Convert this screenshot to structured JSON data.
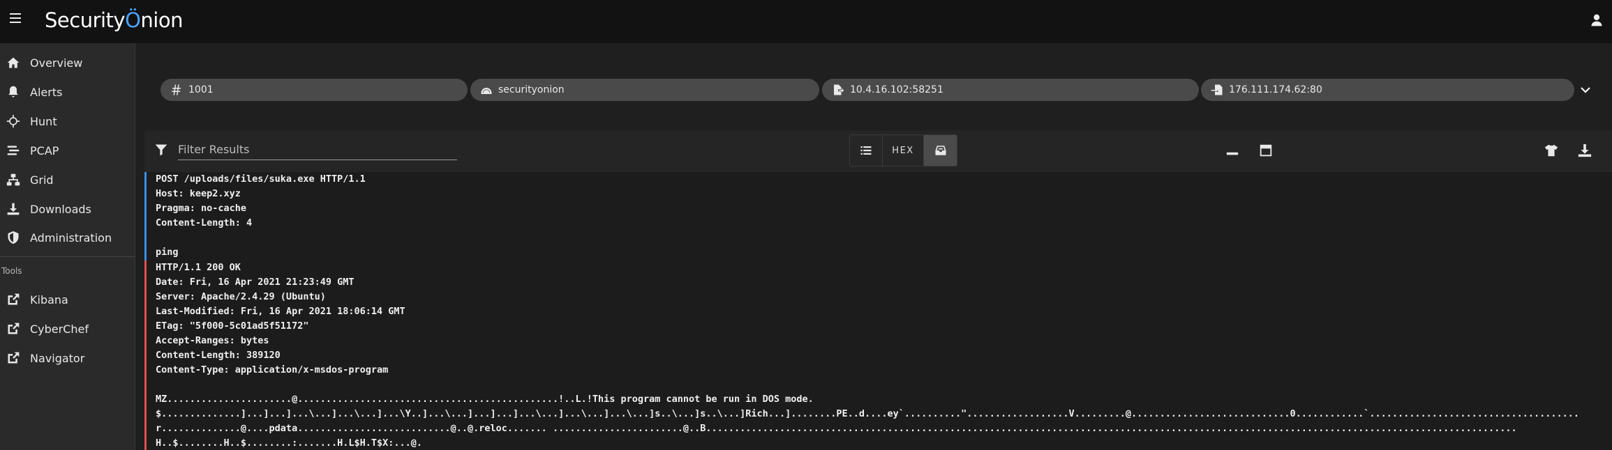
{
  "app": {
    "logo_part1": "Security",
    "logo_part2": "nion"
  },
  "sidebar": {
    "items": [
      {
        "label": "Overview",
        "icon": "home-icon"
      },
      {
        "label": "Alerts",
        "icon": "bell-icon"
      },
      {
        "label": "Hunt",
        "icon": "crosshairs-icon"
      },
      {
        "label": "PCAP",
        "icon": "stream-icon"
      },
      {
        "label": "Grid",
        "icon": "sitemap-icon"
      },
      {
        "label": "Downloads",
        "icon": "download-icon"
      },
      {
        "label": "Administration",
        "icon": "shield-icon"
      }
    ],
    "tools_header": "Tools",
    "tools": [
      {
        "label": "Kibana",
        "icon": "external-link-icon"
      },
      {
        "label": "CyberChef",
        "icon": "external-link-icon"
      },
      {
        "label": "Navigator",
        "icon": "external-link-icon"
      }
    ]
  },
  "chips": {
    "id": "1001",
    "sensor": "securityonion",
    "source": "10.4.16.102:58251",
    "destination": "176.111.174.62:80"
  },
  "toolbar": {
    "filter_placeholder": "Filter Results",
    "hex_label": "HEX"
  },
  "stream": {
    "request_lines": [
      "POST /uploads/files/suka.exe HTTP/1.1",
      "Host: keep2.xyz",
      "Pragma: no-cache",
      "Content-Length: 4",
      "",
      "ping"
    ],
    "response_lines": [
      "HTTP/1.1 200 OK",
      "Date: Fri, 16 Apr 2021 21:23:49 GMT",
      "Server: Apache/2.4.29 (Ubuntu)",
      "Last-Modified: Fri, 16 Apr 2021 18:06:14 GMT",
      "ETag: \"5f000-5c01ad5f51172\"",
      "Accept-Ranges: bytes",
      "Content-Length: 389120",
      "Content-Type: application/x-msdos-program",
      "",
      "MZ......................@..............................................!..L.!This program cannot be run in DOS mode.",
      "$..............]...]...]...\\...]...\\...]...\\Y..]...\\...]...]...]...\\...]...\\...]...\\...]s..\\...]s..\\...]Rich...]........PE..d....ey`..........\"..................V.........@............................0............`.....................................",
      "r..............@....pdata...........................@..@.reloc....... .......................@..B...............................................................................................................................................",
      "H..$........H..$........:.......H.L$H.T$X:...@."
    ]
  }
}
